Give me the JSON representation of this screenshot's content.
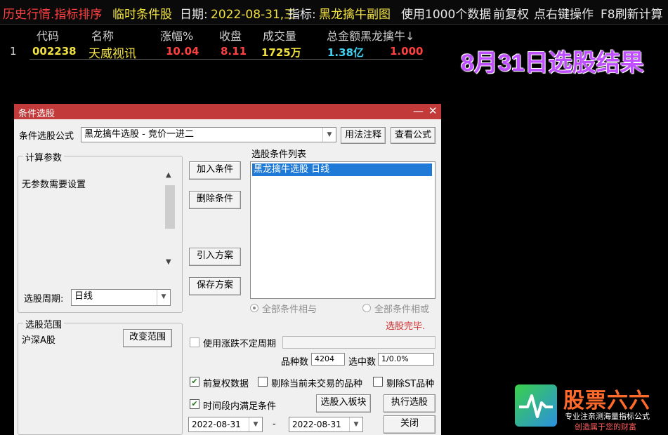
{
  "topbar": {
    "history": "历史行情.指标排序",
    "temp_condition": "临时条件股",
    "date_label": "日期:",
    "date_value": "2022-08-31,三",
    "indicator_label": "指标:",
    "indicator_value": "黑龙擒牛副图",
    "usage": "使用1000个数据",
    "adjust": "前复权",
    "rightclick": "点右键操作",
    "refresh": "F8刷新计算"
  },
  "table": {
    "headers": [
      "代码",
      "名称",
      "涨幅%",
      "收盘",
      "成交量",
      "总金额",
      "黑龙擒牛↓"
    ],
    "rows": [
      {
        "index": "1",
        "code": "002238",
        "name": "天威视讯",
        "change": "10.04",
        "close": "8.11",
        "volume": "1725万",
        "amount": "1.38亿",
        "signal": "1.000"
      }
    ]
  },
  "promo_text": "8月31日选股结果",
  "dialog": {
    "title": "条件选股",
    "minimize": "—",
    "close": "✕",
    "formula_label": "条件选股公式",
    "formula_value": "黑龙擒牛选股 - 竞价一进二",
    "usage_btn": "用法注释",
    "view_formula_btn": "查看公式",
    "params_group": "计算参数",
    "params_text": "无参数需要设置",
    "period_label": "选股周期:",
    "period_value": "日线",
    "add_btn": "加入条件",
    "delete_btn": "删除条件",
    "import_btn": "引入方案",
    "save_btn": "保存方案",
    "condlist_label": "选股条件列表",
    "condlist_items": [
      "黑龙擒牛选股  日线"
    ],
    "radio_and": "全部条件相与",
    "radio_or": "全部条件相或",
    "status": "选股完毕.",
    "scope_group": "选股范围",
    "scope_value": "沪深A股",
    "change_scope_btn": "改变范围",
    "use_period_label": "使用涨跌不定周期",
    "species_label": "品种数",
    "species_value": "4204",
    "selected_label": "选中数",
    "selected_value": "1/0.0%",
    "fq_label": "前复权数据",
    "exclude_untraded_label": "剔除当前未交易的品种",
    "exclude_st_label": "剔除ST品种",
    "period_meet_label": "时间段内满足条件",
    "to_block_btn": "选股入板块",
    "run_btn": "执行选股",
    "close_btn": "关闭",
    "date_from": "2022-08-31",
    "date_sep": "-",
    "date_to": "2022-08-31"
  },
  "logo": {
    "title": "股票六六",
    "sub1": "专业注亲测海量指标公式",
    "sub2": "创造属于您的财富"
  }
}
